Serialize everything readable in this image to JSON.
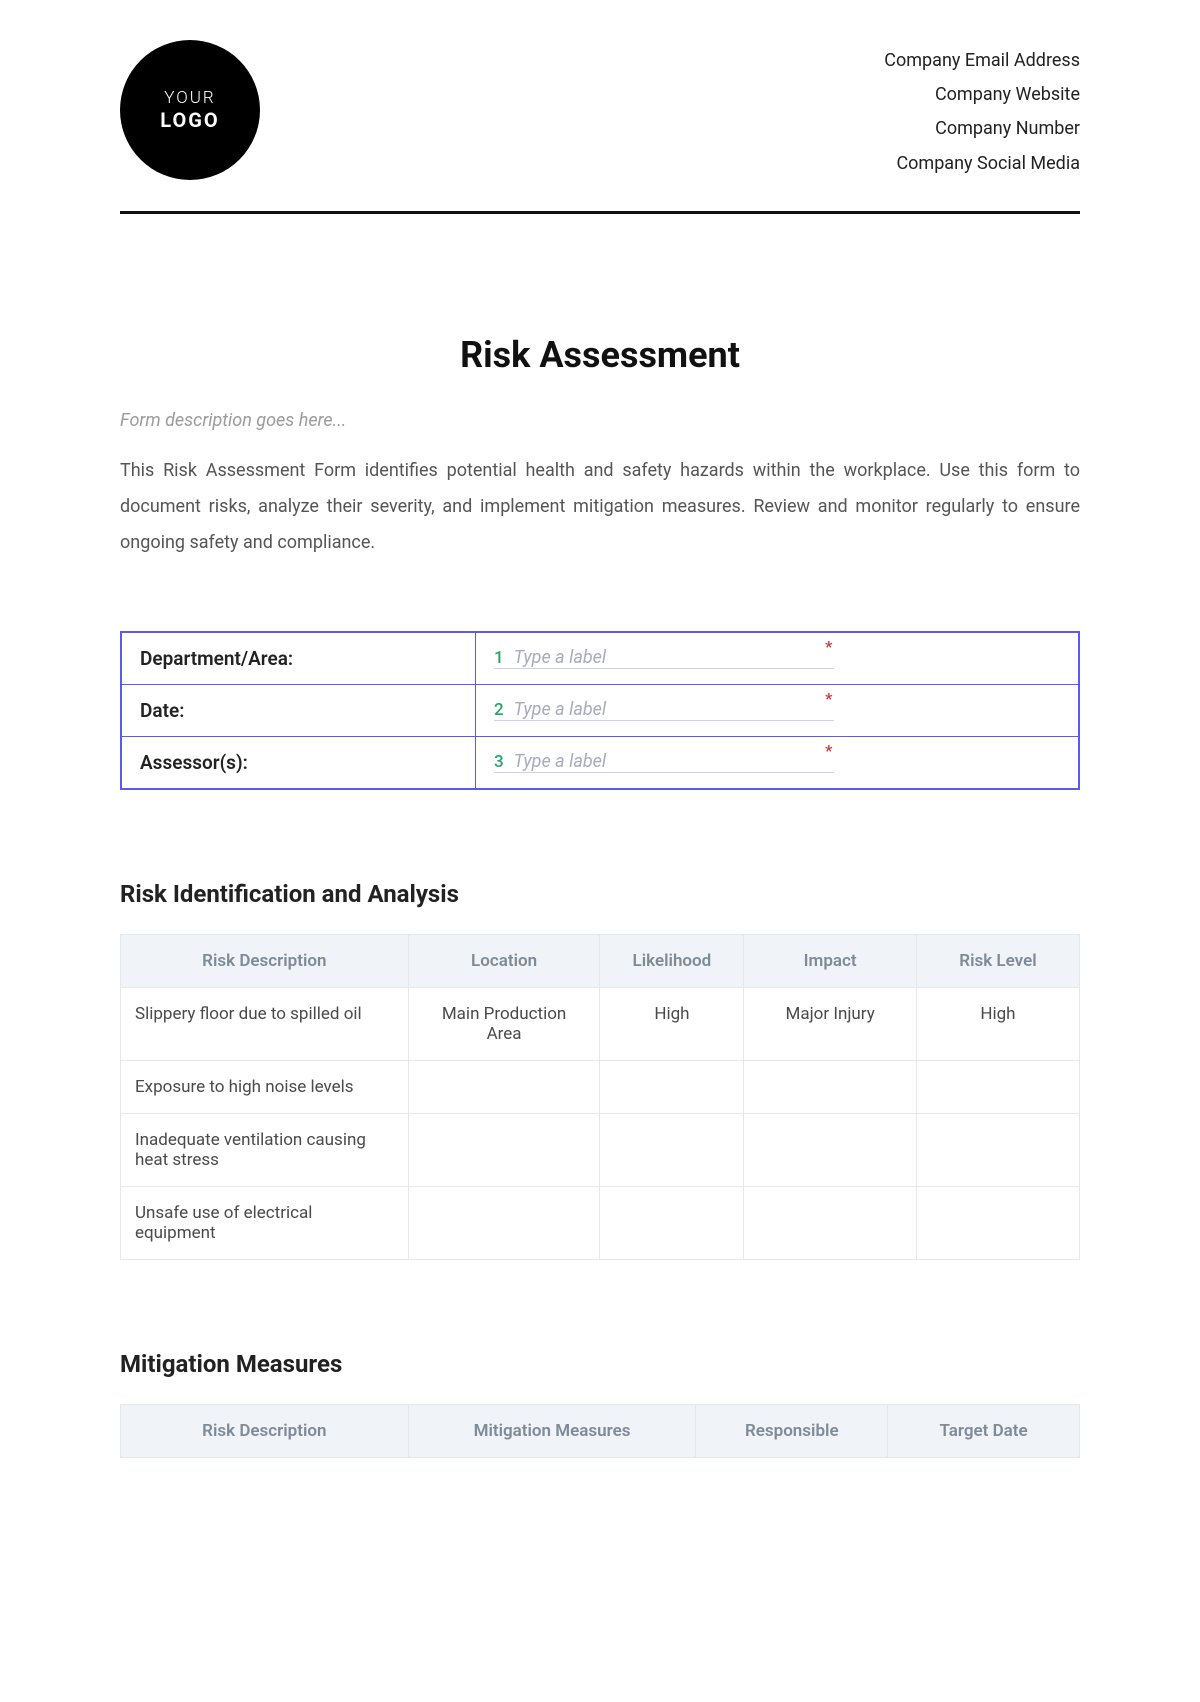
{
  "header": {
    "logo_line1": "YOUR",
    "logo_line2": "LOGO",
    "company_lines": [
      "Company Email Address",
      "Company Website",
      "Company Number",
      "Company Social Media"
    ]
  },
  "title": "Risk Assessment",
  "form_description_placeholder": "Form description goes here...",
  "intro": "This Risk Assessment Form identifies potential health and safety hazards within the workplace. Use this form to document risks, analyze their severity, and implement mitigation measures. Review and monitor regularly to ensure ongoing safety and compliance.",
  "fields": [
    {
      "label": "Department/Area:",
      "num": "1",
      "placeholder": "Type a label"
    },
    {
      "label": "Date:",
      "num": "2",
      "placeholder": "Type a label"
    },
    {
      "label": "Assessor(s):",
      "num": "3",
      "placeholder": "Type a label"
    }
  ],
  "risk_section": {
    "title": "Risk Identification and Analysis",
    "headers": [
      "Risk Description",
      "Location",
      "Likelihood",
      "Impact",
      "Risk Level"
    ],
    "rows": [
      {
        "desc": "Slippery floor due to spilled oil",
        "location": "Main Production Area",
        "likelihood": "High",
        "impact": "Major Injury",
        "level": "High"
      },
      {
        "desc": "Exposure to high noise levels",
        "location": "",
        "likelihood": "",
        "impact": "",
        "level": ""
      },
      {
        "desc": "Inadequate ventilation causing heat stress",
        "location": "",
        "likelihood": "",
        "impact": "",
        "level": ""
      },
      {
        "desc": "Unsafe use of electrical equipment",
        "location": "",
        "likelihood": "",
        "impact": "",
        "level": ""
      }
    ]
  },
  "mitigation_section": {
    "title": "Mitigation Measures",
    "headers": [
      "Risk Description",
      "Mitigation Measures",
      "Responsible",
      "Target Date"
    ]
  }
}
